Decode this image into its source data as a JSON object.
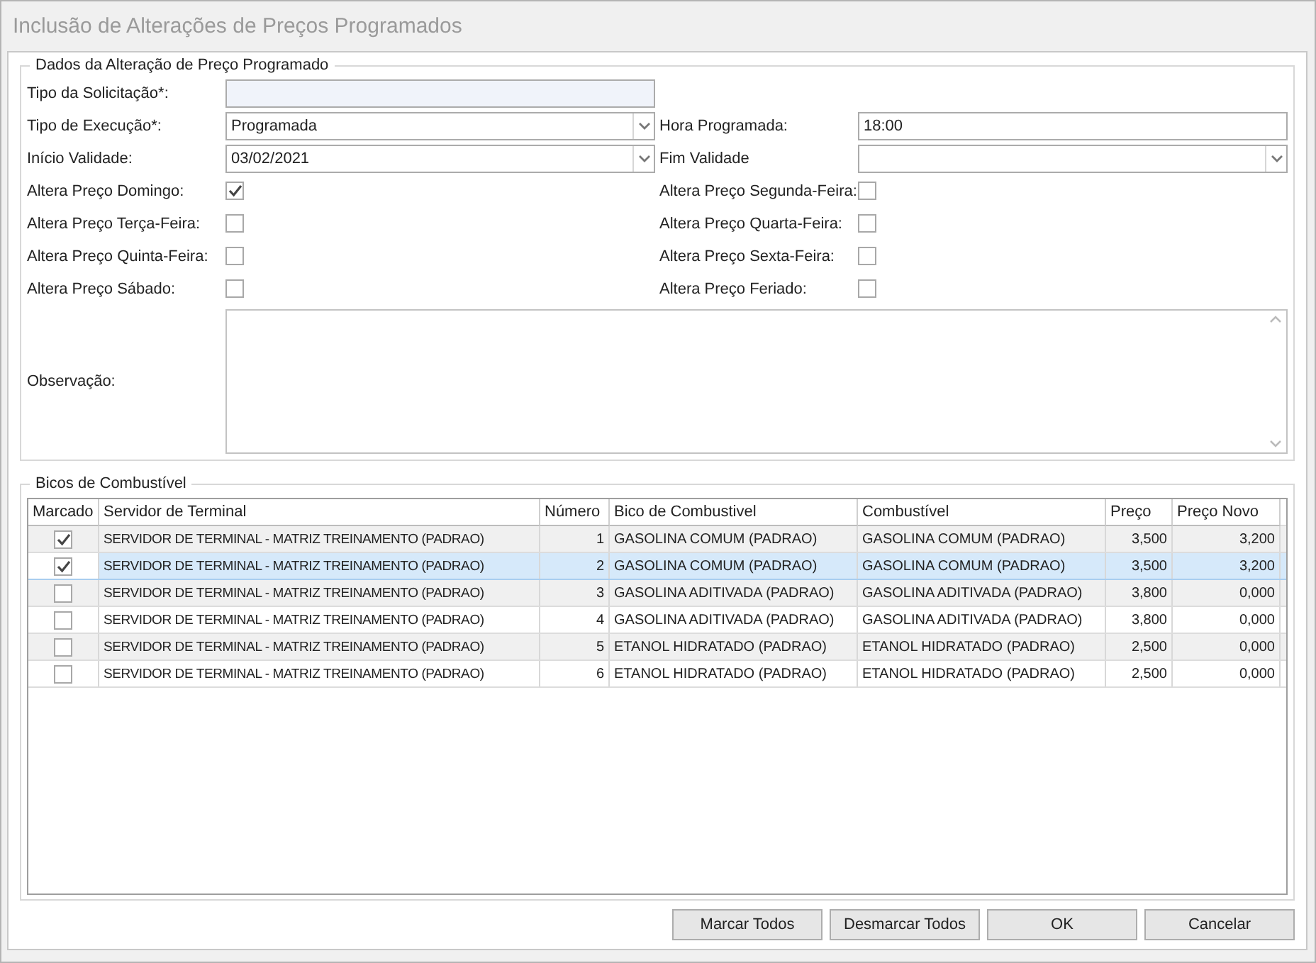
{
  "window": {
    "title": "Inclusão de Alterações de Preços Programados"
  },
  "details": {
    "legend": "Dados da Alteração de Preço Programado",
    "rows": [
      [
        {
          "label": "Tipo da Solicitação*:",
          "kind": "text"
        }
      ],
      [
        {
          "label": "Tipo de Execução*:",
          "kind": "combo",
          "value": "Programada"
        },
        {
          "label": "Hora Programada:",
          "kind": "text",
          "value": "18:00"
        }
      ],
      [
        {
          "label": "Início Validade:",
          "kind": "combo",
          "value": "03/02/2021"
        },
        {
          "label": "Fim Validade",
          "kind": "combo"
        }
      ],
      [
        {
          "label": "Altera Preço Domingo:",
          "kind": "check",
          "checked": true
        },
        {
          "label": "Altera Preço Segunda-Feira:",
          "kind": "check",
          "checked": false
        }
      ],
      [
        {
          "label": "Altera Preço Terça-Feira:",
          "kind": "check",
          "checked": false
        },
        {
          "label": "Altera Preço Quarta-Feira:",
          "kind": "check",
          "checked": false
        }
      ],
      [
        {
          "label": "Altera Preço Quinta-Feira:",
          "kind": "check",
          "checked": false
        },
        {
          "label": "Altera Preço Sexta-Feira:",
          "kind": "check",
          "checked": false
        }
      ],
      [
        {
          "label": "Altera Preço Sábado:",
          "kind": "check",
          "checked": false
        },
        {
          "label": "Altera Preço Feriado:",
          "kind": "check",
          "checked": false
        }
      ]
    ],
    "observation": {
      "label": "Observação:"
    }
  },
  "nozzles": {
    "legend": "Bicos de Combustível",
    "columns": [
      "Marcado",
      "Servidor de Terminal",
      "Número",
      "Bico de Combustivel",
      "Combustível",
      "Preço",
      "Preço Novo"
    ],
    "rows": [
      {
        "checked": true,
        "selected": false,
        "server": "SERVIDOR DE TERMINAL - MATRIZ TREINAMENTO (PADRAO)",
        "number": "1",
        "nozzle": "GASOLINA COMUM (PADRAO)",
        "fuel": "GASOLINA COMUM (PADRAO)",
        "price": "3,500",
        "new_price": "3,200"
      },
      {
        "checked": true,
        "selected": true,
        "server": "SERVIDOR DE TERMINAL - MATRIZ TREINAMENTO (PADRAO)",
        "number": "2",
        "nozzle": "GASOLINA COMUM (PADRAO)",
        "fuel": "GASOLINA COMUM (PADRAO)",
        "price": "3,500",
        "new_price": "3,200"
      },
      {
        "checked": false,
        "selected": false,
        "server": "SERVIDOR DE TERMINAL - MATRIZ TREINAMENTO (PADRAO)",
        "number": "3",
        "nozzle": "GASOLINA ADITIVADA (PADRAO)",
        "fuel": "GASOLINA ADITIVADA (PADRAO)",
        "price": "3,800",
        "new_price": "0,000"
      },
      {
        "checked": false,
        "selected": false,
        "server": "SERVIDOR DE TERMINAL - MATRIZ TREINAMENTO (PADRAO)",
        "number": "4",
        "nozzle": "GASOLINA ADITIVADA (PADRAO)",
        "fuel": "GASOLINA ADITIVADA (PADRAO)",
        "price": "3,800",
        "new_price": "0,000"
      },
      {
        "checked": false,
        "selected": false,
        "server": "SERVIDOR DE TERMINAL - MATRIZ TREINAMENTO (PADRAO)",
        "number": "5",
        "nozzle": "ETANOL HIDRATADO (PADRAO)",
        "fuel": "ETANOL HIDRATADO (PADRAO)",
        "price": "2,500",
        "new_price": "0,000"
      },
      {
        "checked": false,
        "selected": false,
        "server": "SERVIDOR DE TERMINAL - MATRIZ TREINAMENTO (PADRAO)",
        "number": "6",
        "nozzle": "ETANOL HIDRATADO (PADRAO)",
        "fuel": "ETANOL HIDRATADO (PADRAO)",
        "price": "2,500",
        "new_price": "0,000"
      }
    ]
  },
  "buttons": [
    "Marcar Todos",
    "Desmarcar Todos",
    "OK",
    "Cancelar"
  ]
}
